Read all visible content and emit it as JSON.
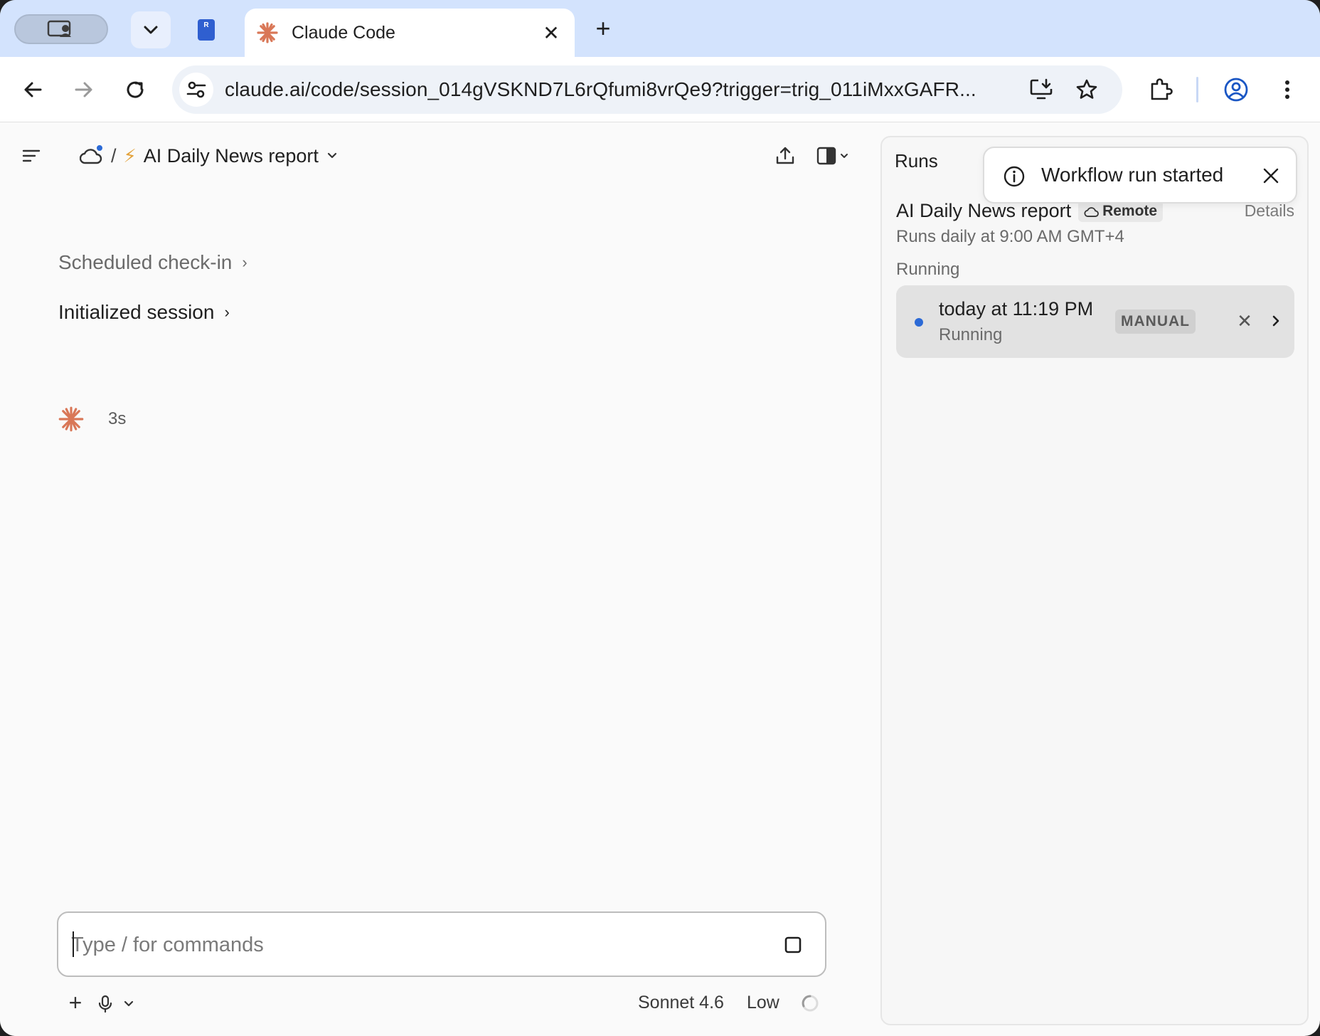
{
  "browser": {
    "tabs": {
      "pinned_favicon_letter": "R",
      "active": {
        "title": "Claude Code",
        "favicon": "claude-asterisk-icon"
      }
    },
    "address_bar": {
      "url": "claude.ai/code/session_014gVSKND7L6rQfumi8vrQe9?trigger=trig_011iMxxGAFR..."
    },
    "accent_color": "#d3e3fd"
  },
  "header": {
    "workflow_title": "AI Daily News report",
    "separator": "/",
    "bolt_glyph": "⚡"
  },
  "conversation": {
    "items": [
      {
        "label": "Scheduled check-in",
        "muted": true
      },
      {
        "label": "Initialized session",
        "muted": false
      }
    ],
    "elapsed": "3s"
  },
  "composer": {
    "placeholder": "Type / for commands",
    "model": "Sonnet 4.6",
    "effort": "Low"
  },
  "runs_panel": {
    "title": "Runs",
    "workflow_name": "AI Daily News report",
    "location_badge": "Remote",
    "details_label": "Details",
    "schedule": "Runs daily at 9:00 AM GMT+4",
    "section_label": "Running",
    "runs": [
      {
        "time": "today at 11:19 PM",
        "status": "Running",
        "trigger": "MANUAL"
      }
    ]
  },
  "toast": {
    "message": "Workflow run started"
  },
  "colors": {
    "brand_orange": "#d97757",
    "status_blue": "#2c6ad6",
    "bolt_yellow": "#e3a23b"
  }
}
